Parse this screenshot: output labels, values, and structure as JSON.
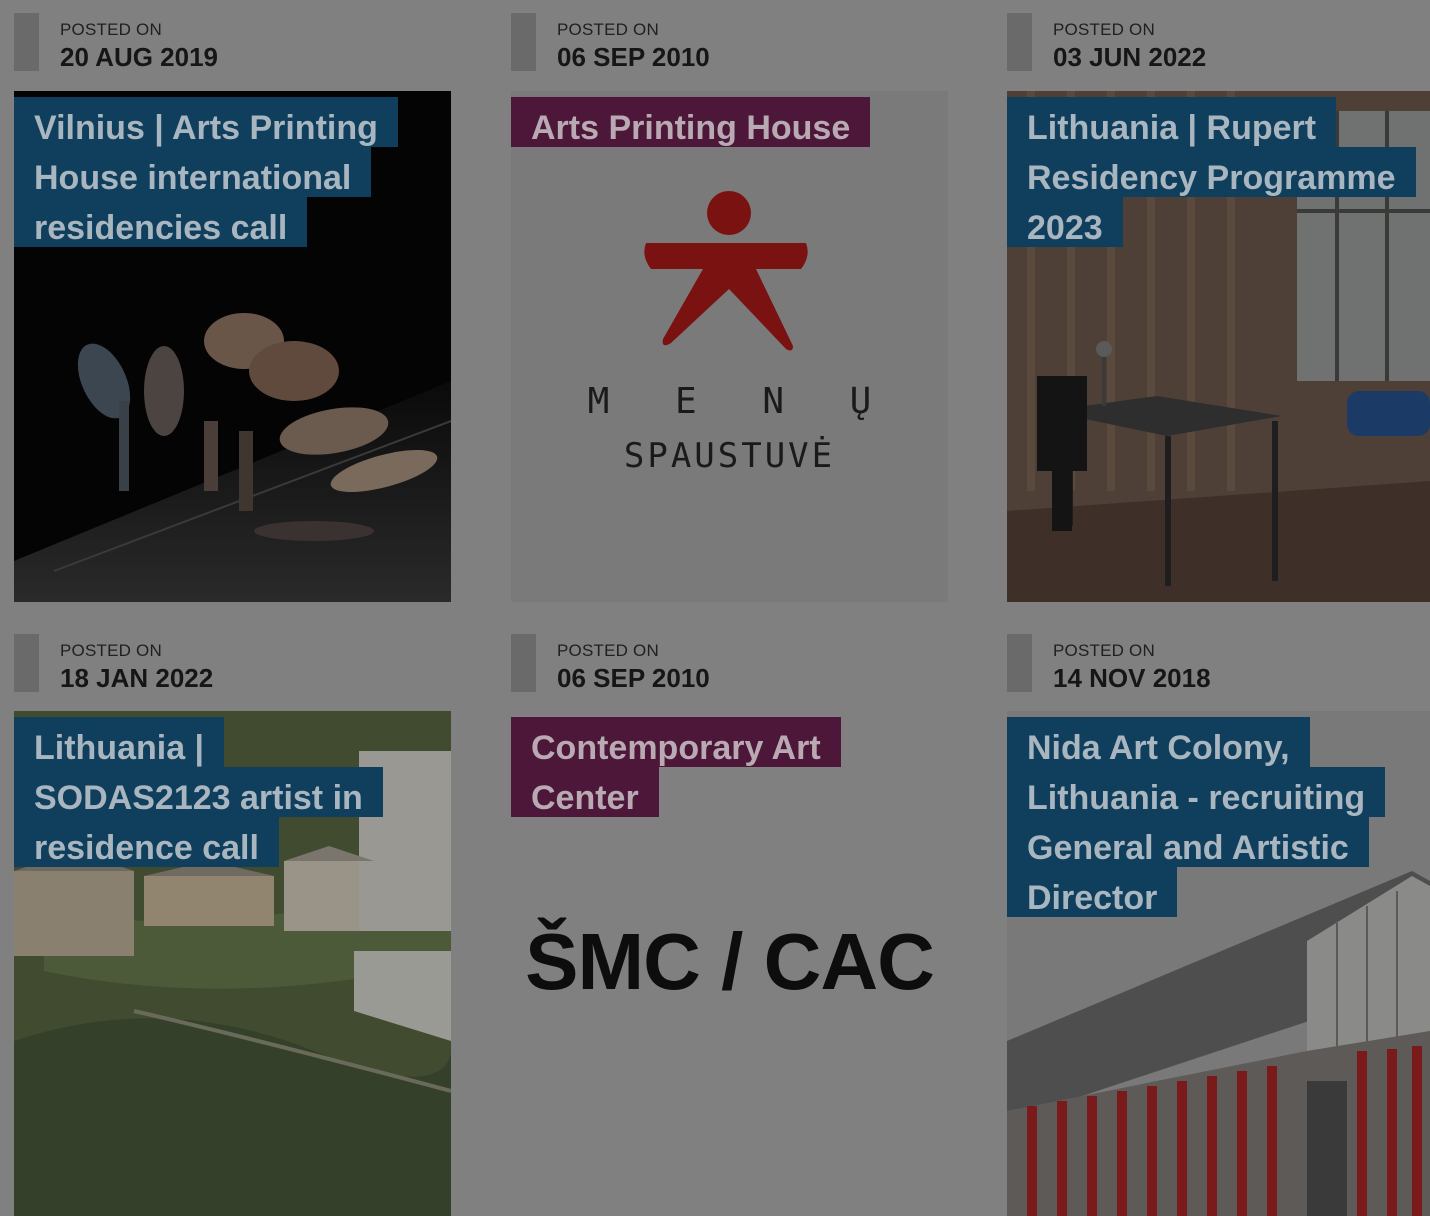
{
  "posted_label": "POSTED ON",
  "cards": [
    {
      "date": "20 AUG 2019",
      "title_lines": [
        "Vilnius | Arts Printing",
        "House international",
        "residencies call"
      ],
      "title_color": "#0f3f5d",
      "image": "dance-photo"
    },
    {
      "date": "06 SEP 2010",
      "title_lines": [
        "Arts Printing House"
      ],
      "title_color": "#4c1739",
      "image": "menu-spaustuve-logo",
      "logo_text": [
        "M E N Ų",
        "SPAUSTUVĖ"
      ]
    },
    {
      "date": "03 JUN 2022",
      "title_lines": [
        "Lithuania | Rupert",
        "Residency Programme",
        "2023"
      ],
      "title_color": "#0f3f5d",
      "image": "residency-room-photo"
    },
    {
      "date": "18 JAN 2022",
      "title_lines": [
        "Lithuania |",
        "SODAS2123 artist in",
        "residence call"
      ],
      "title_color": "#0f3f5d",
      "image": "aerial-photo"
    },
    {
      "date": "06 SEP 2010",
      "title_lines": [
        "Contemporary Art",
        "Center"
      ],
      "title_color": "#4c1739",
      "image": "smc-cac-logo",
      "logo_text": [
        "ŠMC / CAC"
      ]
    },
    {
      "date": "14 NOV 2018",
      "title_lines": [
        "Nida Art Colony,",
        "Lithuania - recruiting",
        "General and Artistic",
        "Director"
      ],
      "title_color": "#0f3f5d",
      "image": "nida-building-photo"
    }
  ]
}
